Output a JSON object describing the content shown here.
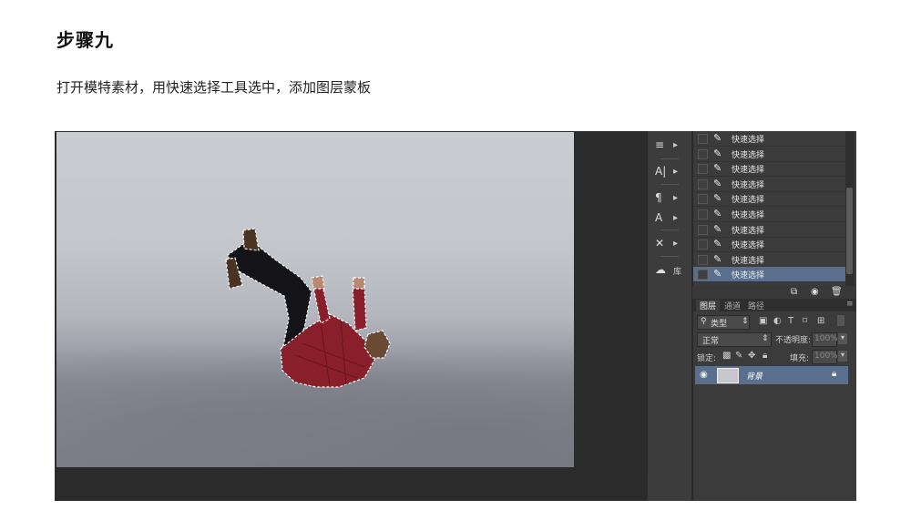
{
  "step": {
    "title": "步骤九",
    "description": "打开模特素材，用快速选择工具选中，添加图层蒙板"
  },
  "tools": [
    {
      "icon": "paragraph-styles-icon",
      "glyph": "≡"
    },
    {
      "icon": "character-icon",
      "glyph": "A|"
    },
    {
      "icon": "paragraph-icon",
      "glyph": "¶"
    },
    {
      "icon": "glyph-styles-icon",
      "glyph": "A"
    },
    {
      "icon": "tool-presets-icon",
      "glyph": "✕"
    },
    {
      "icon": "libraries-icon",
      "glyph": "☁",
      "label": "库"
    }
  ],
  "history": {
    "items": [
      "快速选择",
      "快速选择",
      "快速选择",
      "快速选择",
      "快速选择",
      "快速选择",
      "快速选择",
      "快速选择",
      "快速选择",
      "快速选择"
    ],
    "selected_index": 9
  },
  "layers_panel": {
    "tabs": [
      "图层",
      "通道",
      "路径"
    ],
    "active_tab": 0,
    "filter_kind": "类型",
    "blend_mode": "正常",
    "opacity_label": "不透明度:",
    "opacity_value": "100%",
    "lock_label": "锁定:",
    "fill_label": "填充:",
    "fill_value": "100%",
    "layer": {
      "name": "背景",
      "visible": true,
      "locked": true
    }
  },
  "colors": {
    "selection_highlight": "#5a6f8e",
    "panel_bg": "#3b3b3b",
    "shirt": "#8a1f2c"
  }
}
